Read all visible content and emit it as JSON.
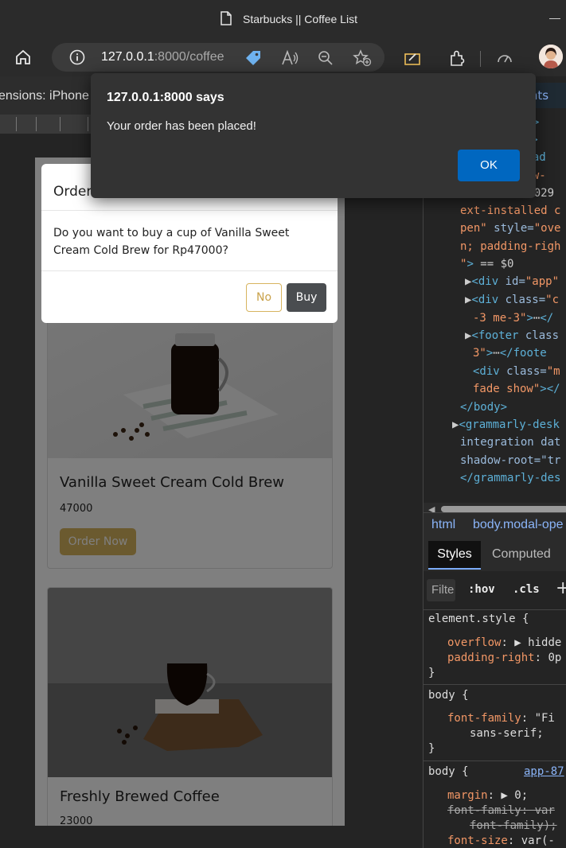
{
  "browser": {
    "window_title": "Starbucks || Coffee List",
    "url_host": "127.0.0.1",
    "url_rest": ":8000/coffee",
    "device_label": "ensions: iPhone X"
  },
  "alert": {
    "title": "127.0.0.1:8000 says",
    "message": "Your order has been placed!",
    "ok_label": "OK"
  },
  "modal": {
    "title": "Order",
    "body": "Do you want to buy a cup of Vanilla Sweet Cream Cold Brew for Rp47000?",
    "no_label": "No",
    "buy_label": "Buy"
  },
  "products": [
    {
      "name": "Vanilla Sweet Cream Cold Brew",
      "price": "47000",
      "button": "Order Now"
    },
    {
      "name": "Freshly Brewed Coffee",
      "price": "23000"
    }
  ],
  "devtools": {
    "tab": "ments",
    "elements_lines": [
      {
        "parts": [
          {
            "c": "c-tag",
            "t": "ml>"
          }
        ]
      },
      {
        "parts": [
          {
            "c": "c-val",
            "t": "en\""
          },
          {
            "c": "c-tag",
            "t": ">"
          }
        ]
      },
      {
        "parts": [
          {
            "c": "c-tag",
            "t": "head"
          }
        ]
      },
      {
        "parts": [
          {
            "c": "c-val",
            "t": "new-"
          }
        ]
      },
      {
        "parts": [
          {
            "c": "c-txt",
            "t": "loaded 14.1029"
          }
        ]
      },
      {
        "parts": [
          {
            "c": "c-val",
            "t": "ext-installed c"
          }
        ]
      },
      {
        "parts": [
          {
            "c": "c-val",
            "t": "pen\""
          },
          {
            "c": "c-attr",
            "t": " style="
          },
          {
            "c": "c-val",
            "t": "\"ove"
          }
        ]
      },
      {
        "parts": [
          {
            "c": "c-val",
            "t": "n; padding-righ"
          }
        ]
      },
      {
        "parts": [
          {
            "c": "c-val",
            "t": "\""
          },
          {
            "c": "c-tag",
            "t": ">"
          },
          {
            "c": "c-txt",
            "t": " == $0"
          }
        ]
      },
      {
        "parts": [
          {
            "c": "c-txt",
            "t": "▶"
          },
          {
            "c": "c-tag",
            "t": "<div"
          },
          {
            "c": "c-attr",
            "t": " id="
          },
          {
            "c": "c-val",
            "t": "\"app\""
          }
        ]
      },
      {
        "parts": [
          {
            "c": "c-txt",
            "t": "▶"
          },
          {
            "c": "c-tag",
            "t": "<div"
          },
          {
            "c": "c-attr",
            "t": " class="
          },
          {
            "c": "c-val",
            "t": "\"c"
          }
        ]
      },
      {
        "parts": [
          {
            "c": "c-val",
            "t": "-3 me-3\""
          },
          {
            "c": "c-tag",
            "t": ">"
          },
          {
            "c": "c-txt",
            "t": "⋯"
          },
          {
            "c": "c-tag",
            "t": "</"
          }
        ]
      },
      {
        "parts": [
          {
            "c": "c-txt",
            "t": "▶"
          },
          {
            "c": "c-tag",
            "t": "<footer"
          },
          {
            "c": "c-attr",
            "t": " class"
          }
        ]
      },
      {
        "parts": [
          {
            "c": "c-val",
            "t": "3\""
          },
          {
            "c": "c-tag",
            "t": ">"
          },
          {
            "c": "c-txt",
            "t": "⋯"
          },
          {
            "c": "c-tag",
            "t": "</foote"
          }
        ]
      },
      {
        "parts": [
          {
            "c": "c-tag",
            "t": "<div"
          },
          {
            "c": "c-attr",
            "t": " class="
          },
          {
            "c": "c-val",
            "t": "\"m"
          }
        ]
      },
      {
        "parts": [
          {
            "c": "c-val",
            "t": "fade show\""
          },
          {
            "c": "c-tag",
            "t": "></"
          }
        ]
      },
      {
        "parts": [
          {
            "c": "c-tag",
            "t": "</body>"
          }
        ]
      },
      {
        "parts": [
          {
            "c": "c-txt",
            "t": "▶"
          },
          {
            "c": "c-tag",
            "t": "<grammarly-desk"
          }
        ]
      },
      {
        "parts": [
          {
            "c": "c-attr",
            "t": "integration dat"
          }
        ]
      },
      {
        "parts": [
          {
            "c": "c-attr",
            "t": "shadow-root=\"tr"
          }
        ]
      },
      {
        "parts": [
          {
            "c": "c-tag",
            "t": "</grammarly-des"
          }
        ]
      }
    ],
    "crumbs": [
      "html",
      "body.modal-ope"
    ],
    "styles_tab": "Styles",
    "computed_tab": "Computed",
    "filter_placeholder": "Filte",
    "hov": ":hov",
    "cls": ".cls",
    "rules": {
      "element_style": "element.style {",
      "overflow": "overflow",
      "overflow_val": "hidde",
      "padding_right": "padding-right",
      "padding_right_val": "0p",
      "close": "}",
      "body1": "body {",
      "font_family": "font-family",
      "font_family_val": "\"Fi",
      "sans_serif": "sans-serif;",
      "body2": "body {",
      "source_link": "app-87",
      "margin": "margin",
      "margin_val": "0;",
      "font_family_struck": "font-family: var",
      "font_family_struck2": "font-family);",
      "font_size": "font-size",
      "font_size_val": "var(-"
    }
  },
  "colors": {
    "accent_gold": "#d7b45f",
    "ok_blue": "#0067c0",
    "buy_dark": "#4a4d50"
  }
}
